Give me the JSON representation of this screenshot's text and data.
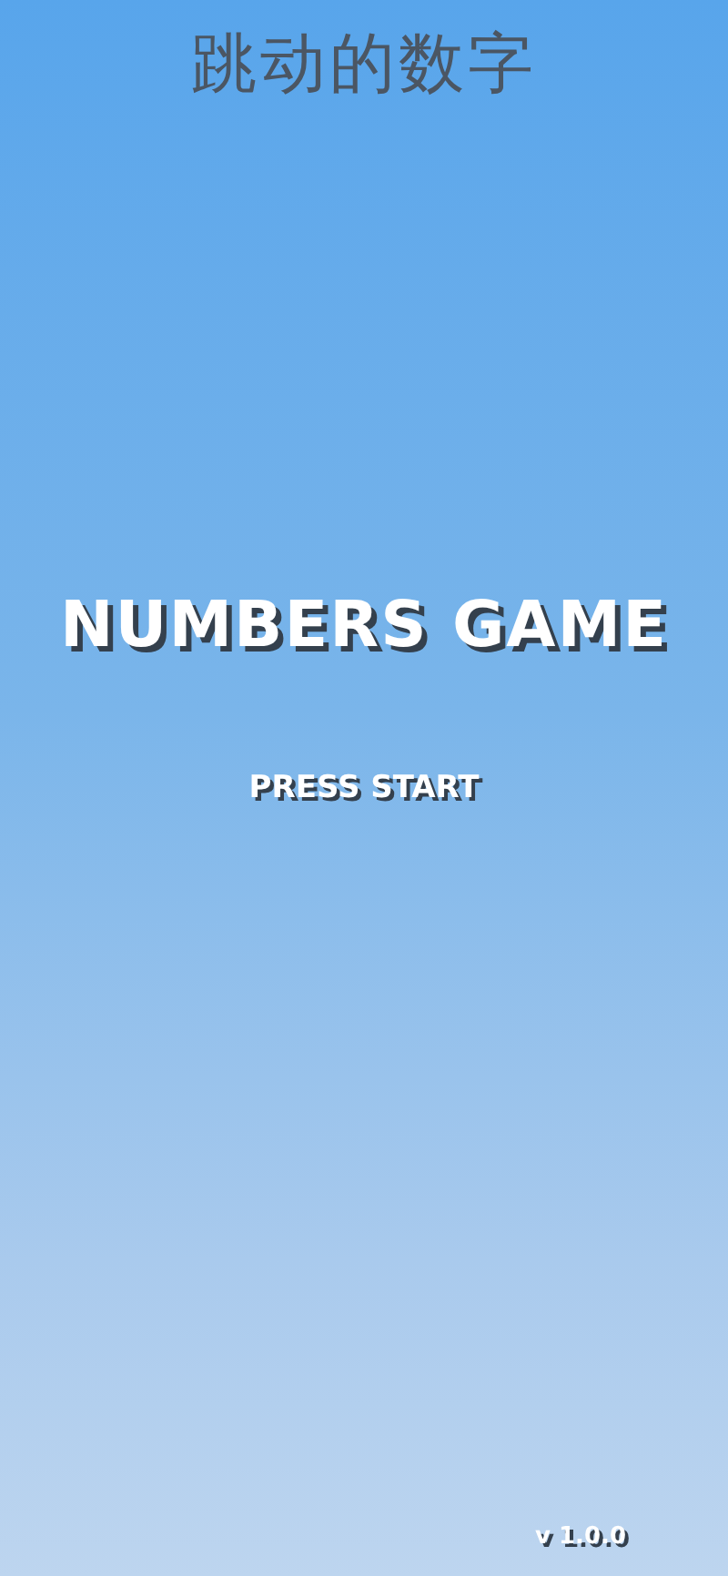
{
  "header": {
    "title": "跳动的数字"
  },
  "game_title": "NUMBERS GAME",
  "start_button": {
    "label": "PRESS START"
  },
  "version": "v 1.0.0"
}
